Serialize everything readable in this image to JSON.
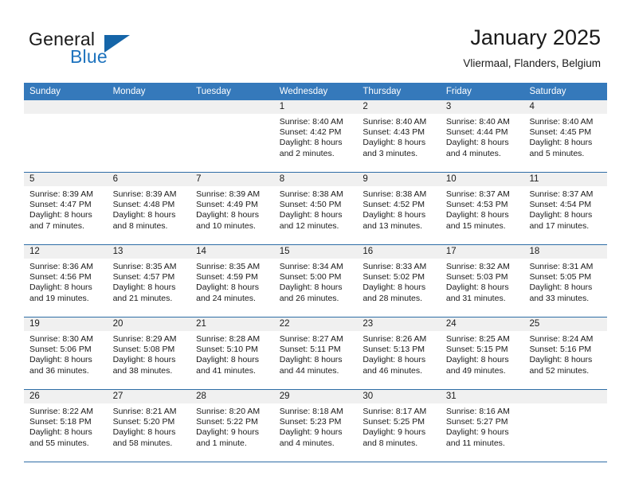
{
  "brand": {
    "name_part1": "General",
    "name_part2": "Blue",
    "logo_icon": "triangle-logo-icon"
  },
  "header": {
    "month_title": "January 2025",
    "location": "Vliermaal, Flanders, Belgium"
  },
  "colors": {
    "header_blue": "#3579bb",
    "row_divider_blue": "#2e6da6",
    "day_band_gray": "#f0f0f0",
    "brand_blue": "#1e73be"
  },
  "weekdays": [
    "Sunday",
    "Monday",
    "Tuesday",
    "Wednesday",
    "Thursday",
    "Friday",
    "Saturday"
  ],
  "weeks": [
    [
      {
        "day": "",
        "empty": true,
        "sunrise": "",
        "sunset": "",
        "daylight1": "",
        "daylight2": ""
      },
      {
        "day": "",
        "empty": true,
        "sunrise": "",
        "sunset": "",
        "daylight1": "",
        "daylight2": ""
      },
      {
        "day": "",
        "empty": true,
        "sunrise": "",
        "sunset": "",
        "daylight1": "",
        "daylight2": ""
      },
      {
        "day": "1",
        "empty": false,
        "sunrise": "Sunrise: 8:40 AM",
        "sunset": "Sunset: 4:42 PM",
        "daylight1": "Daylight: 8 hours",
        "daylight2": "and 2 minutes."
      },
      {
        "day": "2",
        "empty": false,
        "sunrise": "Sunrise: 8:40 AM",
        "sunset": "Sunset: 4:43 PM",
        "daylight1": "Daylight: 8 hours",
        "daylight2": "and 3 minutes."
      },
      {
        "day": "3",
        "empty": false,
        "sunrise": "Sunrise: 8:40 AM",
        "sunset": "Sunset: 4:44 PM",
        "daylight1": "Daylight: 8 hours",
        "daylight2": "and 4 minutes."
      },
      {
        "day": "4",
        "empty": false,
        "sunrise": "Sunrise: 8:40 AM",
        "sunset": "Sunset: 4:45 PM",
        "daylight1": "Daylight: 8 hours",
        "daylight2": "and 5 minutes."
      }
    ],
    [
      {
        "day": "5",
        "empty": false,
        "sunrise": "Sunrise: 8:39 AM",
        "sunset": "Sunset: 4:47 PM",
        "daylight1": "Daylight: 8 hours",
        "daylight2": "and 7 minutes."
      },
      {
        "day": "6",
        "empty": false,
        "sunrise": "Sunrise: 8:39 AM",
        "sunset": "Sunset: 4:48 PM",
        "daylight1": "Daylight: 8 hours",
        "daylight2": "and 8 minutes."
      },
      {
        "day": "7",
        "empty": false,
        "sunrise": "Sunrise: 8:39 AM",
        "sunset": "Sunset: 4:49 PM",
        "daylight1": "Daylight: 8 hours",
        "daylight2": "and 10 minutes."
      },
      {
        "day": "8",
        "empty": false,
        "sunrise": "Sunrise: 8:38 AM",
        "sunset": "Sunset: 4:50 PM",
        "daylight1": "Daylight: 8 hours",
        "daylight2": "and 12 minutes."
      },
      {
        "day": "9",
        "empty": false,
        "sunrise": "Sunrise: 8:38 AM",
        "sunset": "Sunset: 4:52 PM",
        "daylight1": "Daylight: 8 hours",
        "daylight2": "and 13 minutes."
      },
      {
        "day": "10",
        "empty": false,
        "sunrise": "Sunrise: 8:37 AM",
        "sunset": "Sunset: 4:53 PM",
        "daylight1": "Daylight: 8 hours",
        "daylight2": "and 15 minutes."
      },
      {
        "day": "11",
        "empty": false,
        "sunrise": "Sunrise: 8:37 AM",
        "sunset": "Sunset: 4:54 PM",
        "daylight1": "Daylight: 8 hours",
        "daylight2": "and 17 minutes."
      }
    ],
    [
      {
        "day": "12",
        "empty": false,
        "sunrise": "Sunrise: 8:36 AM",
        "sunset": "Sunset: 4:56 PM",
        "daylight1": "Daylight: 8 hours",
        "daylight2": "and 19 minutes."
      },
      {
        "day": "13",
        "empty": false,
        "sunrise": "Sunrise: 8:35 AM",
        "sunset": "Sunset: 4:57 PM",
        "daylight1": "Daylight: 8 hours",
        "daylight2": "and 21 minutes."
      },
      {
        "day": "14",
        "empty": false,
        "sunrise": "Sunrise: 8:35 AM",
        "sunset": "Sunset: 4:59 PM",
        "daylight1": "Daylight: 8 hours",
        "daylight2": "and 24 minutes."
      },
      {
        "day": "15",
        "empty": false,
        "sunrise": "Sunrise: 8:34 AM",
        "sunset": "Sunset: 5:00 PM",
        "daylight1": "Daylight: 8 hours",
        "daylight2": "and 26 minutes."
      },
      {
        "day": "16",
        "empty": false,
        "sunrise": "Sunrise: 8:33 AM",
        "sunset": "Sunset: 5:02 PM",
        "daylight1": "Daylight: 8 hours",
        "daylight2": "and 28 minutes."
      },
      {
        "day": "17",
        "empty": false,
        "sunrise": "Sunrise: 8:32 AM",
        "sunset": "Sunset: 5:03 PM",
        "daylight1": "Daylight: 8 hours",
        "daylight2": "and 31 minutes."
      },
      {
        "day": "18",
        "empty": false,
        "sunrise": "Sunrise: 8:31 AM",
        "sunset": "Sunset: 5:05 PM",
        "daylight1": "Daylight: 8 hours",
        "daylight2": "and 33 minutes."
      }
    ],
    [
      {
        "day": "19",
        "empty": false,
        "sunrise": "Sunrise: 8:30 AM",
        "sunset": "Sunset: 5:06 PM",
        "daylight1": "Daylight: 8 hours",
        "daylight2": "and 36 minutes."
      },
      {
        "day": "20",
        "empty": false,
        "sunrise": "Sunrise: 8:29 AM",
        "sunset": "Sunset: 5:08 PM",
        "daylight1": "Daylight: 8 hours",
        "daylight2": "and 38 minutes."
      },
      {
        "day": "21",
        "empty": false,
        "sunrise": "Sunrise: 8:28 AM",
        "sunset": "Sunset: 5:10 PM",
        "daylight1": "Daylight: 8 hours",
        "daylight2": "and 41 minutes."
      },
      {
        "day": "22",
        "empty": false,
        "sunrise": "Sunrise: 8:27 AM",
        "sunset": "Sunset: 5:11 PM",
        "daylight1": "Daylight: 8 hours",
        "daylight2": "and 44 minutes."
      },
      {
        "day": "23",
        "empty": false,
        "sunrise": "Sunrise: 8:26 AM",
        "sunset": "Sunset: 5:13 PM",
        "daylight1": "Daylight: 8 hours",
        "daylight2": "and 46 minutes."
      },
      {
        "day": "24",
        "empty": false,
        "sunrise": "Sunrise: 8:25 AM",
        "sunset": "Sunset: 5:15 PM",
        "daylight1": "Daylight: 8 hours",
        "daylight2": "and 49 minutes."
      },
      {
        "day": "25",
        "empty": false,
        "sunrise": "Sunrise: 8:24 AM",
        "sunset": "Sunset: 5:16 PM",
        "daylight1": "Daylight: 8 hours",
        "daylight2": "and 52 minutes."
      }
    ],
    [
      {
        "day": "26",
        "empty": false,
        "sunrise": "Sunrise: 8:22 AM",
        "sunset": "Sunset: 5:18 PM",
        "daylight1": "Daylight: 8 hours",
        "daylight2": "and 55 minutes."
      },
      {
        "day": "27",
        "empty": false,
        "sunrise": "Sunrise: 8:21 AM",
        "sunset": "Sunset: 5:20 PM",
        "daylight1": "Daylight: 8 hours",
        "daylight2": "and 58 minutes."
      },
      {
        "day": "28",
        "empty": false,
        "sunrise": "Sunrise: 8:20 AM",
        "sunset": "Sunset: 5:22 PM",
        "daylight1": "Daylight: 9 hours",
        "daylight2": "and 1 minute."
      },
      {
        "day": "29",
        "empty": false,
        "sunrise": "Sunrise: 8:18 AM",
        "sunset": "Sunset: 5:23 PM",
        "daylight1": "Daylight: 9 hours",
        "daylight2": "and 4 minutes."
      },
      {
        "day": "30",
        "empty": false,
        "sunrise": "Sunrise: 8:17 AM",
        "sunset": "Sunset: 5:25 PM",
        "daylight1": "Daylight: 9 hours",
        "daylight2": "and 8 minutes."
      },
      {
        "day": "31",
        "empty": false,
        "sunrise": "Sunrise: 8:16 AM",
        "sunset": "Sunset: 5:27 PM",
        "daylight1": "Daylight: 9 hours",
        "daylight2": "and 11 minutes."
      },
      {
        "day": "",
        "empty": true,
        "sunrise": "",
        "sunset": "",
        "daylight1": "",
        "daylight2": ""
      }
    ]
  ]
}
